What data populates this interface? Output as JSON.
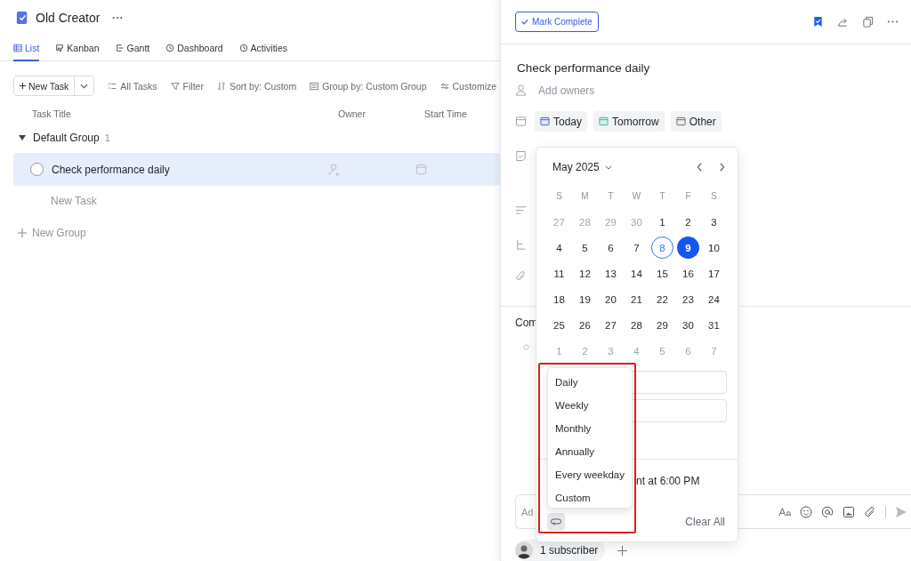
{
  "project": {
    "title": "Old Creator"
  },
  "views": [
    {
      "label": "List",
      "selected": true
    },
    {
      "label": "Kanban",
      "selected": false
    },
    {
      "label": "Gantt",
      "selected": false
    },
    {
      "label": "Dashboard",
      "selected": false
    },
    {
      "label": "Activities",
      "selected": false
    }
  ],
  "toolbar": {
    "new_task": "New Task",
    "actions": [
      "All Tasks",
      "Filter",
      "Sort by: Custom",
      "Group by: Custom Group",
      "Customize"
    ]
  },
  "columns": [
    "Task Title",
    "Owner",
    "Start Time"
  ],
  "groups": [
    {
      "name": "Default Group",
      "count": "1",
      "expanded": true,
      "new_task": "New Task",
      "tasks": [
        {
          "title": "Check performance daily",
          "selected": true
        }
      ]
    }
  ],
  "new_group": "New Group",
  "detail": {
    "mark_complete": "Mark Complete",
    "title": "Check performance daily",
    "owners_placeholder": "Add owners",
    "date_options": [
      "Today",
      "Tomorrow",
      "Other"
    ],
    "comments_label": "Com",
    "comment_placeholder": "Ad",
    "subscribers": "1 subscriber"
  },
  "date_picker": {
    "month": "May 2025",
    "weekdays": [
      "S",
      "M",
      "T",
      "W",
      "T",
      "F",
      "S"
    ],
    "weeks": [
      [
        {
          "day": "27",
          "muted": true,
          "today": false,
          "selected": false
        },
        {
          "day": "28",
          "muted": true,
          "today": false,
          "selected": false
        },
        {
          "day": "29",
          "muted": true,
          "today": false,
          "selected": false
        },
        {
          "day": "30",
          "muted": true,
          "today": false,
          "selected": false
        },
        {
          "day": "1",
          "muted": false,
          "today": false,
          "selected": false
        },
        {
          "day": "2",
          "muted": false,
          "today": false,
          "selected": false
        },
        {
          "day": "3",
          "muted": false,
          "today": false,
          "selected": false
        }
      ],
      [
        {
          "day": "4",
          "muted": false,
          "today": false,
          "selected": false
        },
        {
          "day": "5",
          "muted": false,
          "today": false,
          "selected": false
        },
        {
          "day": "6",
          "muted": false,
          "today": false,
          "selected": false
        },
        {
          "day": "7",
          "muted": false,
          "today": false,
          "selected": false
        },
        {
          "day": "8",
          "muted": false,
          "today": true,
          "selected": false
        },
        {
          "day": "9",
          "muted": false,
          "today": false,
          "selected": true
        },
        {
          "day": "10",
          "muted": false,
          "today": false,
          "selected": false
        }
      ],
      [
        {
          "day": "11",
          "muted": false,
          "today": false,
          "selected": false
        },
        {
          "day": "12",
          "muted": false,
          "today": false,
          "selected": false
        },
        {
          "day": "13",
          "muted": false,
          "today": false,
          "selected": false
        },
        {
          "day": "14",
          "muted": false,
          "today": false,
          "selected": false
        },
        {
          "day": "15",
          "muted": false,
          "today": false,
          "selected": false
        },
        {
          "day": "16",
          "muted": false,
          "today": false,
          "selected": false
        },
        {
          "day": "17",
          "muted": false,
          "today": false,
          "selected": false
        }
      ],
      [
        {
          "day": "18",
          "muted": false,
          "today": false,
          "selected": false
        },
        {
          "day": "19",
          "muted": false,
          "today": false,
          "selected": false
        },
        {
          "day": "20",
          "muted": false,
          "today": false,
          "selected": false
        },
        {
          "day": "21",
          "muted": false,
          "today": false,
          "selected": false
        },
        {
          "day": "22",
          "muted": false,
          "today": false,
          "selected": false
        },
        {
          "day": "23",
          "muted": false,
          "today": false,
          "selected": false
        },
        {
          "day": "24",
          "muted": false,
          "today": false,
          "selected": false
        }
      ],
      [
        {
          "day": "25",
          "muted": false,
          "today": false,
          "selected": false
        },
        {
          "day": "26",
          "muted": false,
          "today": false,
          "selected": false
        },
        {
          "day": "27",
          "muted": false,
          "today": false,
          "selected": false
        },
        {
          "day": "28",
          "muted": false,
          "today": false,
          "selected": false
        },
        {
          "day": "29",
          "muted": false,
          "today": false,
          "selected": false
        },
        {
          "day": "30",
          "muted": false,
          "today": false,
          "selected": false
        },
        {
          "day": "31",
          "muted": false,
          "today": false,
          "selected": false
        }
      ],
      [
        {
          "day": "1",
          "muted": true,
          "today": false,
          "selected": false
        },
        {
          "day": "2",
          "muted": true,
          "today": false,
          "selected": false
        },
        {
          "day": "3",
          "muted": true,
          "today": false,
          "selected": false
        },
        {
          "day": "4",
          "muted": true,
          "today": false,
          "selected": false
        },
        {
          "day": "5",
          "muted": true,
          "today": false,
          "selected": false
        },
        {
          "day": "6",
          "muted": true,
          "today": false,
          "selected": false
        },
        {
          "day": "7",
          "muted": true,
          "today": false,
          "selected": false
        }
      ]
    ],
    "reminder_text": "nt at 6:00 PM",
    "clear_all": "Clear All",
    "repeat_active": true
  },
  "repeat_menu": [
    "Daily",
    "Weekly",
    "Monthly",
    "Annually",
    "Every weekday",
    "Custom"
  ]
}
